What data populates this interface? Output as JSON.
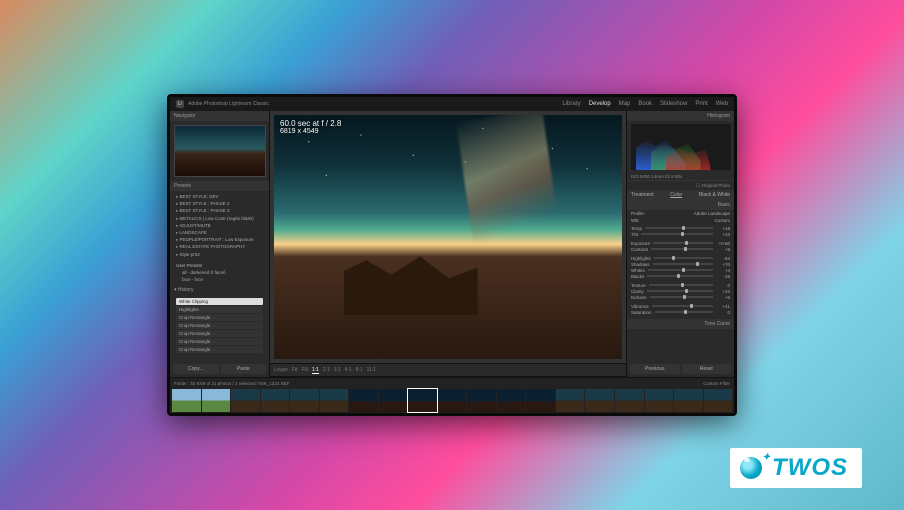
{
  "app": {
    "logo_text": "Lr",
    "name_line1": "Adobe Photoshop",
    "name_line2": "Lightroom Classic"
  },
  "modules": {
    "library": "Library",
    "develop": "Develop",
    "map": "Map",
    "book": "Book",
    "slideshow": "Slideshow",
    "print": "Print",
    "web": "Web",
    "active": "develop"
  },
  "left_panel": {
    "navigator_label": "Navigator",
    "presets_label": "Presets",
    "presets": [
      "BEST STYLE: DEV",
      "BEST STYLE : PHASE 2",
      "BEST STYLE : PHASE 3",
      "METALICS | Low Contr (reg/to bl&W)",
      "ADJUST/MUTE",
      "LANDSCAPE",
      "PEOPLE/PORTRAIT : Low Exposure",
      "REAL ESTATE PHOTOGRAPHY",
      "Style pr02"
    ],
    "user_presets_label": "User Presets",
    "user_presets": [
      "all - darkened fr faceб",
      "face - foce"
    ],
    "history_label": "History",
    "history": [
      "White Clipping",
      "Highlights",
      "Crop Rectangle",
      "Crop Rectangle",
      "Crop Rectangle",
      "Crop Rectangle",
      "Crop Rectangle"
    ],
    "history_selected": 0,
    "copy": "Copy...",
    "paste": "Paste"
  },
  "photo": {
    "exposure": "60.0 sec at f / 2.8",
    "dimensions": "6819 x 4549"
  },
  "tool_strip": {
    "items": [
      "Loupe",
      "Fit",
      "Fill",
      "1:1",
      "2:1",
      "3:1",
      "4:1",
      "8:1",
      "11:1"
    ]
  },
  "right_panel": {
    "histogram_label": "Histogram",
    "camera_info": "ISO 6400  14mm  f/2.8  60s",
    "original_label": "Original Photo",
    "tabs": {
      "treatment": "Treatment",
      "color": "Color",
      "black_white": "Black & White"
    },
    "basic_label": "Basic",
    "profile_label": "Profile:",
    "profile_value": "Adobe Landscape",
    "wb_label": "WB:",
    "wb_value": "Custom",
    "sliders": {
      "temp": {
        "label": "Temp",
        "value": "+18",
        "pos": 54
      },
      "tint": {
        "label": "Tint",
        "value": "+23",
        "pos": 56
      },
      "exposure": {
        "label": "Exposure",
        "value": "+0.60",
        "pos": 54
      },
      "contrast": {
        "label": "Contrast",
        "value": "+8",
        "pos": 53
      },
      "highlights": {
        "label": "Highlights",
        "value": "-64",
        "pos": 30
      },
      "shadows": {
        "label": "Shadows",
        "value": "+70",
        "pos": 72
      },
      "whites": {
        "label": "Whites",
        "value": "+4",
        "pos": 52
      },
      "blacks": {
        "label": "Blacks",
        "value": "-15",
        "pos": 45
      },
      "texture": {
        "label": "Texture",
        "value": "0",
        "pos": 50
      },
      "clarity": {
        "label": "Clarity",
        "value": "+22",
        "pos": 57
      },
      "dehaze": {
        "label": "Dehaze",
        "value": "+6",
        "pos": 52
      },
      "vibrance": {
        "label": "Vibrance",
        "value": "+41",
        "pos": 63
      },
      "saturation": {
        "label": "Saturation",
        "value": "0",
        "pos": 50
      }
    },
    "tone_curve_label": "Tone Curve",
    "previous": "Previous",
    "reset": "Reset"
  },
  "filmstrip": {
    "info_left": "Folder : fol   8:69 of 21 photos / 1 selected / NIK_1234.NEF",
    "filter_label": "Custom Filter"
  },
  "badge": {
    "text": "TWOS"
  }
}
